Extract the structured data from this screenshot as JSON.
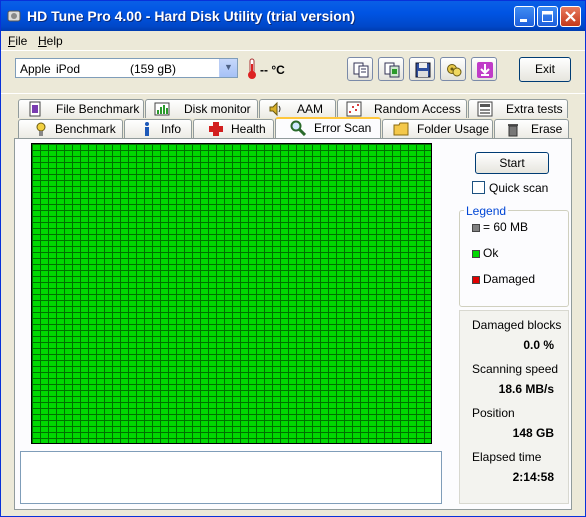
{
  "window": {
    "title": "HD Tune Pro 4.00 - Hard Disk Utility (trial version)"
  },
  "menu": {
    "file": "File",
    "help": "Help"
  },
  "toolbar": {
    "drive_vendor": "Apple",
    "drive_model": "iPod",
    "drive_size": "(159 gB)",
    "temperature": "-- °C",
    "exit_label": "Exit"
  },
  "tabs_top": [
    {
      "label": "File Benchmark",
      "icon": "file-benchmark-icon"
    },
    {
      "label": "Disk monitor",
      "icon": "disk-monitor-icon"
    },
    {
      "label": "AAM",
      "icon": "speaker-icon"
    },
    {
      "label": "Random Access",
      "icon": "random-access-icon"
    },
    {
      "label": "Extra tests",
      "icon": "extra-tests-icon"
    }
  ],
  "tabs_bottom": [
    {
      "label": "Benchmark",
      "icon": "benchmark-icon"
    },
    {
      "label": "Info",
      "icon": "info-icon"
    },
    {
      "label": "Health",
      "icon": "health-icon"
    },
    {
      "label": "Error Scan",
      "icon": "magnifier-icon",
      "active": true
    },
    {
      "label": "Folder Usage",
      "icon": "folder-icon"
    },
    {
      "label": "Erase",
      "icon": "trash-icon"
    }
  ],
  "scan": {
    "start_label": "Start",
    "quick_scan_label": "Quick scan",
    "quick_scan_checked": false,
    "block_status": "all ok"
  },
  "legend": {
    "title": "Legend",
    "items": [
      {
        "label": "= 60 MB",
        "color": "#808080"
      },
      {
        "label": "Ok",
        "color": "#00d800"
      },
      {
        "label": "Damaged",
        "color": "#e00000"
      }
    ]
  },
  "stats": {
    "damaged_label": "Damaged blocks",
    "damaged_value": "0.0 %",
    "speed_label": "Scanning speed",
    "speed_value": "18.6 MB/s",
    "position_label": "Position",
    "position_value": "148 GB",
    "elapsed_label": "Elapsed time",
    "elapsed_value": "2:14:58"
  },
  "colors": {
    "ok": "#00d800",
    "grid_line": "#007000",
    "damaged": "#e00000",
    "title_bar": "#0054e3"
  }
}
